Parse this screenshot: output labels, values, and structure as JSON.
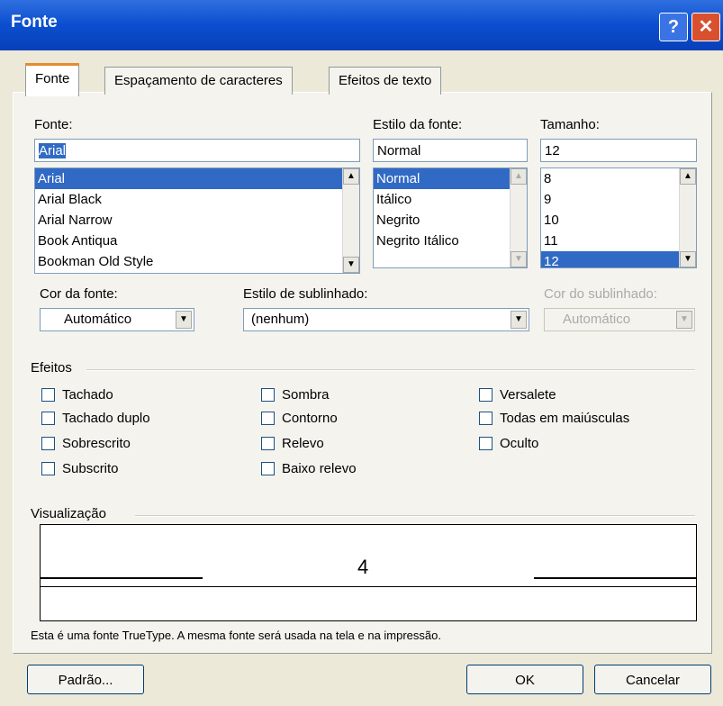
{
  "window": {
    "title": "Fonte"
  },
  "tabs": [
    {
      "label": "Fonte"
    },
    {
      "label": "Espaçamento de caracteres"
    },
    {
      "label": "Efeitos de texto"
    }
  ],
  "font": {
    "label": "Fonte:",
    "value": "Arial",
    "items": [
      "Arial",
      "Arial Black",
      "Arial Narrow",
      "Book Antiqua",
      "Bookman Old Style"
    ]
  },
  "style": {
    "label": "Estilo da fonte:",
    "value": "Normal",
    "items": [
      "Normal",
      "Itálico",
      "Negrito",
      "Negrito Itálico"
    ]
  },
  "size": {
    "label": "Tamanho:",
    "value": "12",
    "items": [
      "8",
      "9",
      "10",
      "11",
      "12"
    ]
  },
  "font_color": {
    "label": "Cor da fonte:",
    "value": "Automático"
  },
  "underline_style": {
    "label": "Estilo de sublinhado:",
    "value": "(nenhum)"
  },
  "underline_color": {
    "label": "Cor do sublinhado:",
    "value": "Automático"
  },
  "effects": {
    "label": "Efeitos",
    "col1": [
      "Tachado",
      "Tachado duplo",
      "Sobrescrito",
      "Subscrito"
    ],
    "col2": [
      "Sombra",
      "Contorno",
      "Relevo",
      "Baixo relevo"
    ],
    "col3": [
      "Versalete",
      "Todas em maiúsculas",
      "Oculto"
    ]
  },
  "preview": {
    "label": "Visualização",
    "text": "4"
  },
  "info": "Esta é uma fonte TrueType. A mesma fonte será usada na tela e na impressão.",
  "buttons": {
    "default": "Padrão...",
    "ok": "OK",
    "cancel": "Cancelar"
  }
}
